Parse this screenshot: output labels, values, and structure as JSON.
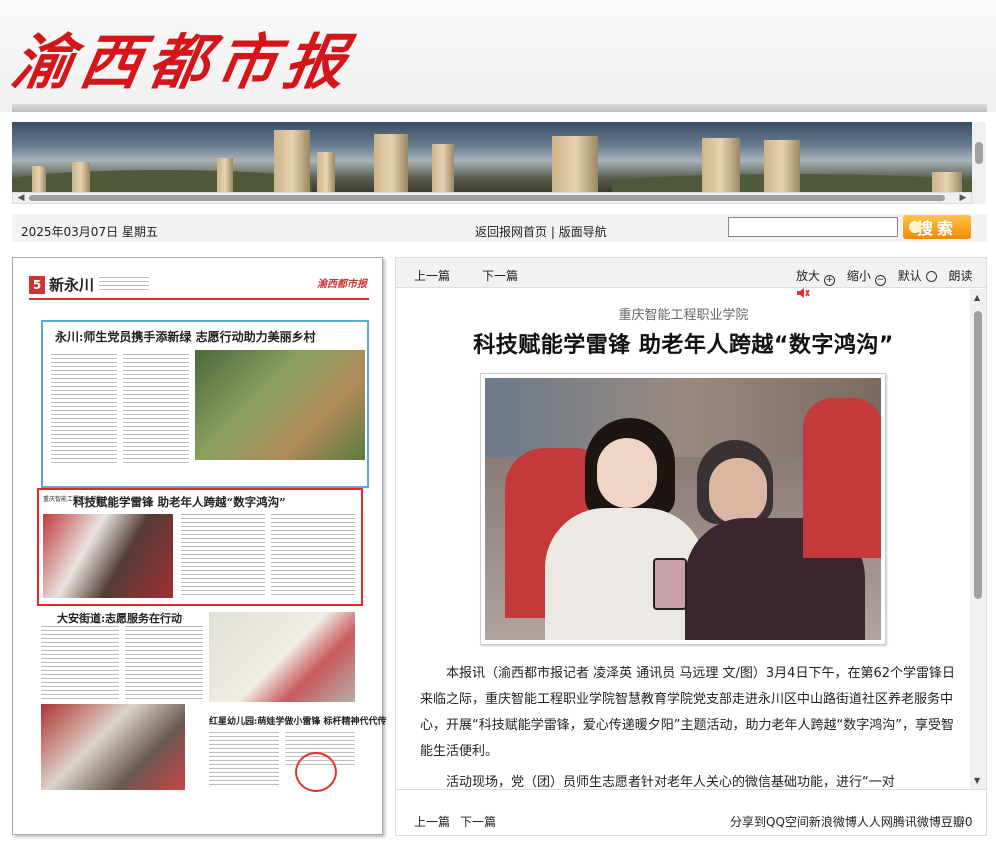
{
  "masthead": {
    "logo": "渝西都市报"
  },
  "navbar": {
    "date": "2025年03月07日 星期五",
    "home_link": "返回报网首页",
    "separator": "|",
    "layout_nav": "版面导航",
    "search_placeholder": "",
    "search_button": "搜索"
  },
  "paper_page": {
    "number": "5",
    "name": "新永川",
    "logo": "渝西都市报",
    "top_story_title": "永川:师生党员携手添新绿 志愿行动助力美丽乡村",
    "feature_kicker": "重庆智能工程职业学院",
    "feature_title": "科技赋能学雷锋 助老年人跨越“数字鸿沟”",
    "story3_title": "大安街道:志愿服务在行动",
    "story4_title": "红星幼儿园:萌娃学做小雷锋 标杆精神代代传"
  },
  "article_toolbar": {
    "prev": "上一篇",
    "next": "下一篇",
    "zoom_in": "放大",
    "zoom_out": "缩小",
    "default": "默认",
    "read_aloud": "朗读"
  },
  "article": {
    "kicker": "重庆智能工程职业学院",
    "headline": "科技赋能学雷锋 助老年人跨越“数字鸿沟”",
    "paragraph1": "本报讯（渝西都市报记者 凌泽英 通讯员 马远理 文/图）3月4日下午，在第62个学雷锋日来临之际，重庆智能工程职业学院智慧教育学院党支部走进永川区中山路街道社区养老服务中心，开展“科技赋能学雷锋，爱心传递暖夕阳”主题活动，助力老年人跨越“数字鸿沟”，享受智能生活便利。",
    "paragraph2": "活动现场，党（团）员师生志愿者针对老年人关心的微信基础功能，进行“一对"
  },
  "footer": {
    "prev": "上一篇",
    "next": "下一篇",
    "share": "分享到QQ空间新浪微博人人网腾讯微博豆瓣0"
  },
  "colors": {
    "brand_red": "#d4161b",
    "search_orange": "#f08a00",
    "frame_blue": "#5aa9d6",
    "highlight_red": "#e22"
  }
}
